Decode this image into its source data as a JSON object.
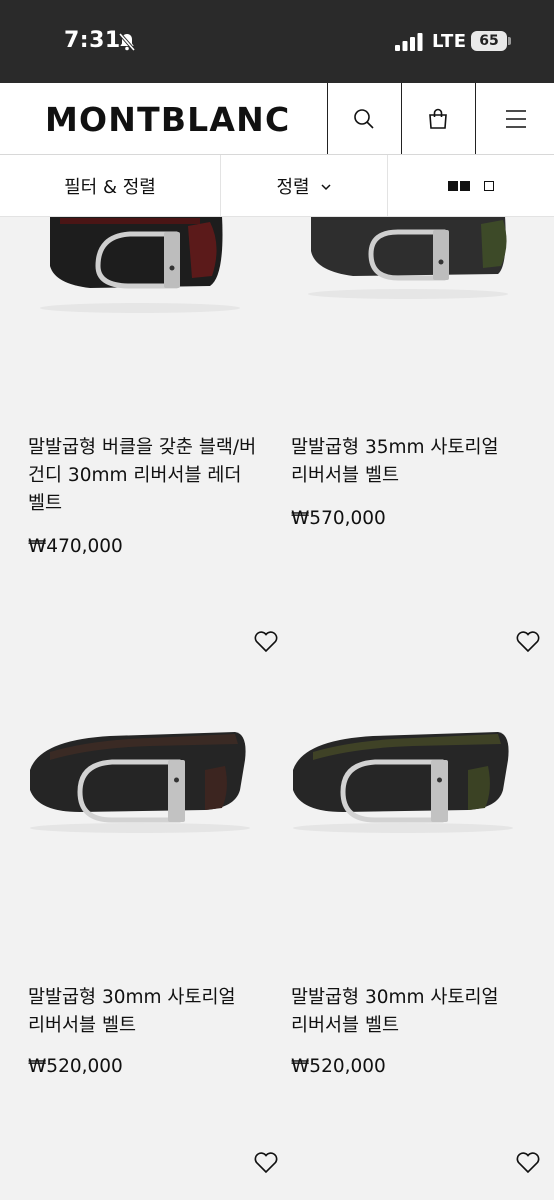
{
  "status_bar": {
    "time": "7:31",
    "network": "LTE",
    "battery": "65"
  },
  "header": {
    "logo": "MONTBLANC",
    "icons": [
      "search-icon",
      "shopping-bag-icon",
      "menu-icon"
    ]
  },
  "filter_bar": {
    "filter_label": "필터 & 정렬",
    "sort_label": "정렬",
    "view_icons": [
      "grid-two-columns-icon",
      "grid-one-column-icon"
    ]
  },
  "colors": {
    "status_bar_bg": "#2a2a2a",
    "page_bg": "#f2f2f2",
    "text": "#111111"
  },
  "products": [
    {
      "name": "말발굽형 버클을 갖춘 블랙/버건디 30mm 리버서블 레더 벨트",
      "price": "₩470,000"
    },
    {
      "name": "말발굽형 35mm 사토리얼 리버서블 벨트",
      "price": "₩570,000"
    },
    {
      "name": "말발굽형 30mm 사토리얼 리버서블 벨트",
      "price": "₩520,000"
    },
    {
      "name": "말발굽형 30mm 사토리얼 리버서블 벨트",
      "price": "₩520,000"
    }
  ]
}
